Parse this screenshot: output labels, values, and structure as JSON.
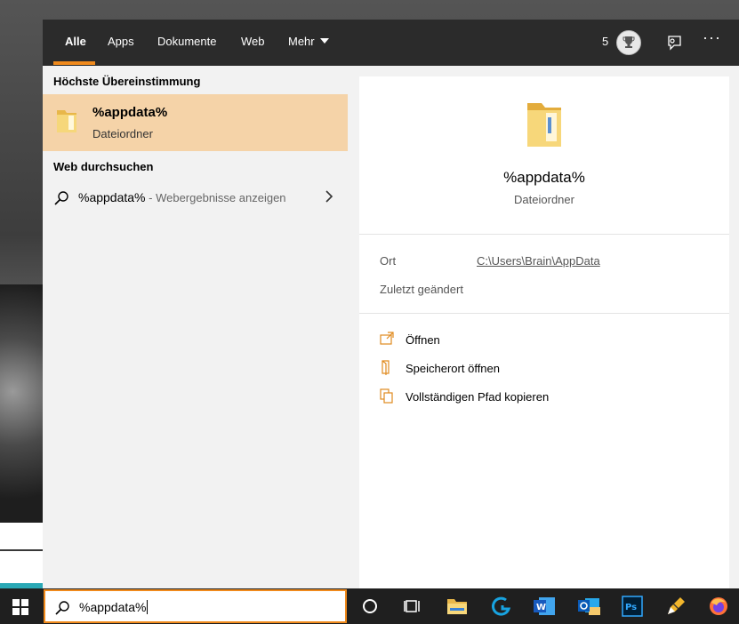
{
  "tabs": [
    {
      "label": "Alle"
    },
    {
      "label": "Apps"
    },
    {
      "label": "Dokumente"
    },
    {
      "label": "Web"
    },
    {
      "label": "Mehr"
    }
  ],
  "header": {
    "points": "5"
  },
  "best_match": {
    "heading": "Höchste Übereinstimmung",
    "title": "%appdata%",
    "subtitle": "Dateiordner"
  },
  "web": {
    "heading": "Web durchsuchen",
    "query": "%appdata%",
    "hint": " - Webergebnisse anzeigen"
  },
  "preview": {
    "title": "%appdata%",
    "subtitle": "Dateiordner",
    "location_label": "Ort",
    "location_value": "C:\\Users\\Brain\\AppData",
    "modified_label": "Zuletzt geändert",
    "actions": [
      {
        "label": "Öffnen",
        "icon": "open-icon"
      },
      {
        "label": "Speicherort öffnen",
        "icon": "file-location-icon"
      },
      {
        "label": "Vollständigen Pfad kopieren",
        "icon": "copy-icon"
      }
    ]
  },
  "search": {
    "value": "%appdata%"
  },
  "taskbar": {
    "icons": [
      "start-icon",
      "cortana-icon",
      "task-view-icon",
      "file-explorer-icon",
      "logitech-icon",
      "word-icon",
      "outlook-icon",
      "photoshop-icon",
      "pen-tool-icon",
      "firefox-icon"
    ]
  },
  "colors": {
    "accent": "#f08a1c",
    "selected": "#f5d3a8",
    "topbar": "#2b2b2b"
  }
}
